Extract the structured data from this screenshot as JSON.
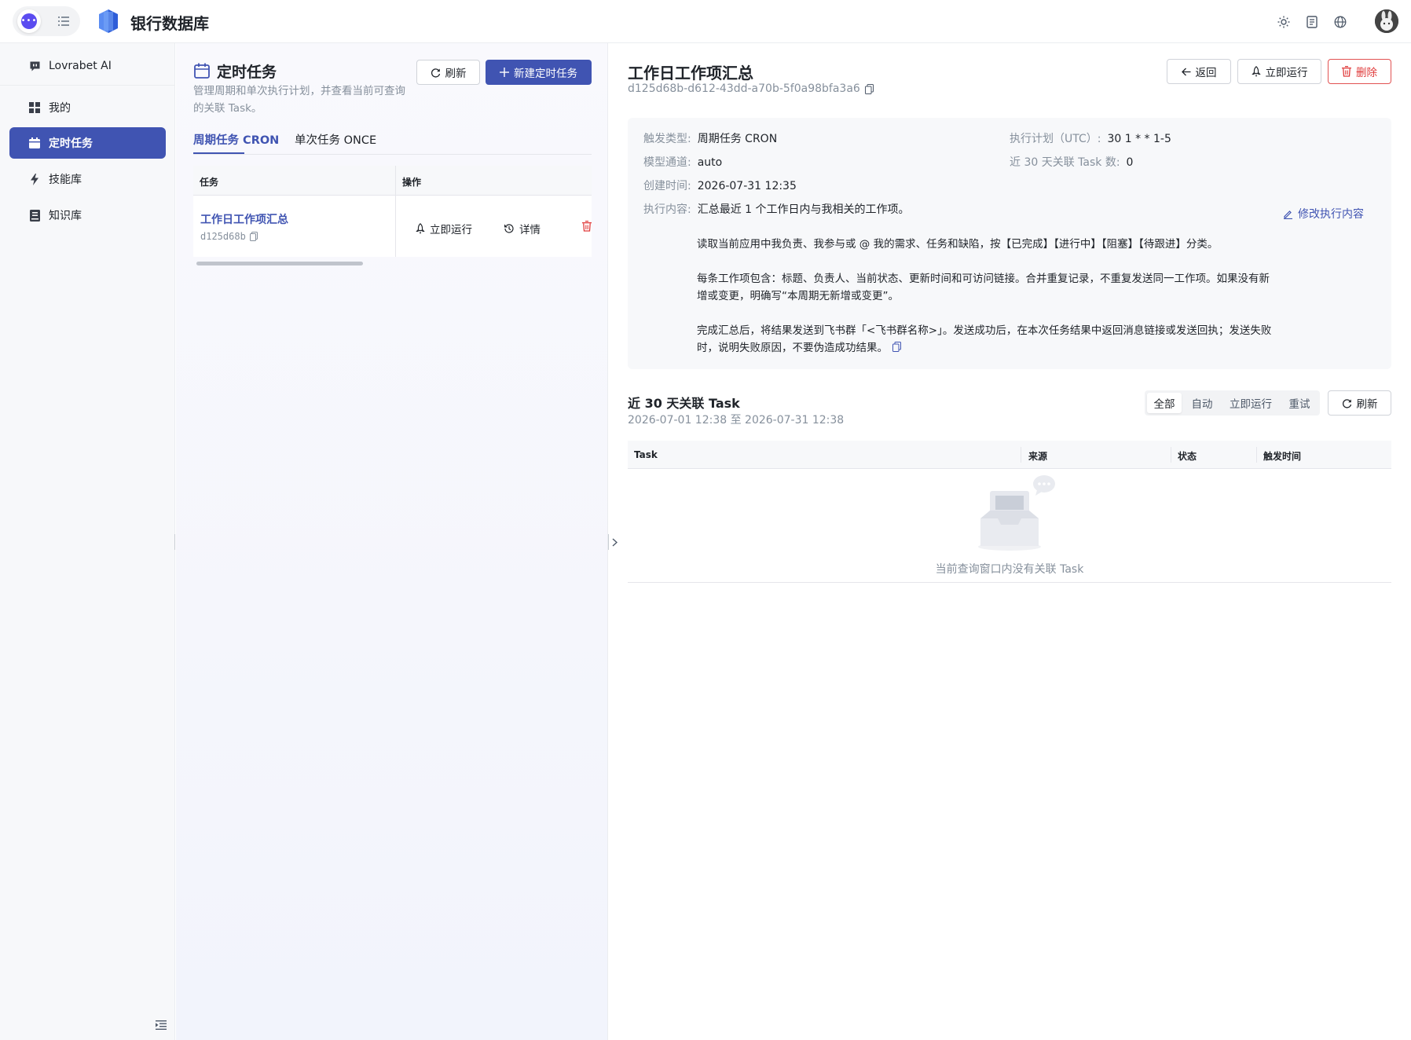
{
  "app": {
    "title": "银行数据库"
  },
  "sidebar": {
    "ai_label": "Lovrabet AI",
    "items": [
      {
        "label": "我的",
        "icon": "grid-icon"
      },
      {
        "label": "定时任务",
        "icon": "calendar-icon",
        "active": true
      },
      {
        "label": "技能库",
        "icon": "bolt-icon"
      },
      {
        "label": "知识库",
        "icon": "book-icon"
      }
    ]
  },
  "schedules": {
    "title": "定时任务",
    "description": "管理周期和单次执行计划，并查看当前可查询的关联 Task。",
    "refresh_label": "刷新",
    "new_label": "新建定时任务",
    "tabs": [
      "周期任务 CRON",
      "单次任务 ONCE"
    ],
    "table": {
      "columns": [
        "任务",
        "操作"
      ],
      "rows": [
        {
          "name": "工作日工作项汇总",
          "short_id": "d125d68b",
          "run_label": "立即运行",
          "detail_label": "详情"
        }
      ]
    }
  },
  "detail": {
    "title": "工作日工作项汇总",
    "id": "d125d68b-d612-43dd-a70b-5f0a98bfa3a6",
    "back_label": "返回",
    "run_label": "立即运行",
    "delete_label": "删除",
    "fields": {
      "trigger_type_label": "触发类型:",
      "trigger_type": "周期任务 CRON",
      "schedule_label": "执行计划（UTC）:",
      "schedule": "30 1 * * 1-5",
      "model_label": "模型通道:",
      "model": "auto",
      "task_count_label": "近 30 天关联 Task 数:",
      "task_count": "0",
      "created_label": "创建时间:",
      "created": "2026-07-31 12:35",
      "content_label": "执行内容:",
      "content_first": "汇总最近 1 个工作日内与我相关的工作项。",
      "content_paragraphs": [
        "读取当前应用中我负责、我参与或 @ 我的需求、任务和缺陷，按【已完成】【进行中】【阻塞】【待跟进】分类。",
        "每条工作项包含：标题、负责人、当前状态、更新时间和可访问链接。合并重复记录，不重复发送同一工作项。如果没有新增或变更，明确写“本周期无新增或变更”。",
        "完成汇总后，将结果发送到飞书群「<飞书群名称>」。发送成功后，在本次任务结果中返回消息链接或发送回执；发送失败时，说明失败原因，不要伪造成功结果。"
      ],
      "edit_label": "修改执行内容"
    },
    "tasks": {
      "title": "近 30 天关联 Task",
      "range": "2026-07-01 12:38 至 2026-07-31 12:38",
      "filters": [
        "全部",
        "自动",
        "立即运行",
        "重试"
      ],
      "refresh_label": "刷新",
      "columns": [
        "Task",
        "来源",
        "状态",
        "触发时间"
      ],
      "empty_text": "当前查询窗口内没有关联 Task"
    }
  }
}
